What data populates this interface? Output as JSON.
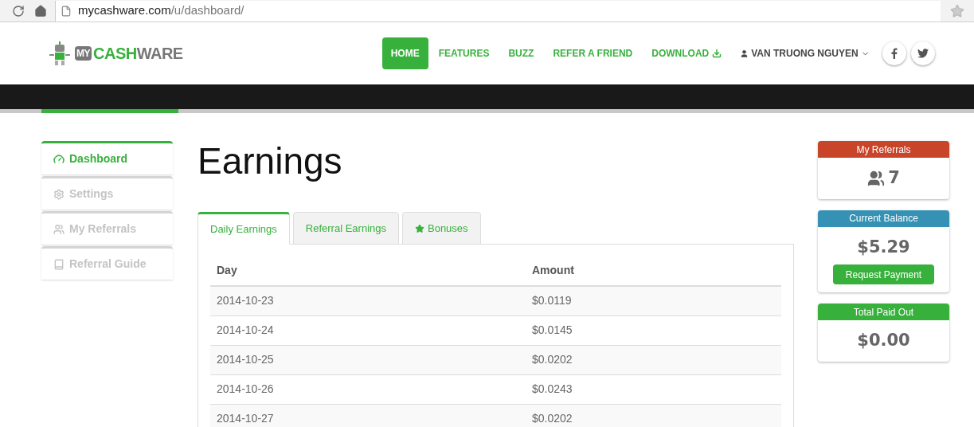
{
  "browser": {
    "url_host": "mycashware.com",
    "url_path": "/u/dashboard/"
  },
  "logo": {
    "my": "MY",
    "cash": "CASH",
    "ware": "WARE"
  },
  "nav": [
    {
      "label": "HOME",
      "selected": true,
      "kind": "plain"
    },
    {
      "label": "FEATURES",
      "selected": false,
      "kind": "plain"
    },
    {
      "label": "BUZZ",
      "selected": false,
      "kind": "plain"
    },
    {
      "label": "REFER A FRIEND",
      "selected": false,
      "kind": "plain"
    },
    {
      "label": "DOWNLOAD",
      "selected": false,
      "kind": "download"
    }
  ],
  "user": {
    "name": "VAN TRUONG NGUYEN"
  },
  "sidebar": {
    "items": [
      {
        "label": "Dashboard",
        "selected": true,
        "kind": "dashboard"
      },
      {
        "label": "Settings",
        "selected": false,
        "kind": "settings"
      },
      {
        "label": "My Referrals",
        "selected": false,
        "kind": "users"
      },
      {
        "label": "Referral Guide",
        "selected": false,
        "kind": "book"
      }
    ]
  },
  "page_title": "Earnings",
  "tabs": [
    {
      "label": "Daily Earnings",
      "selected": true,
      "kind": "plain"
    },
    {
      "label": "Referral Earnings",
      "selected": false,
      "kind": "plain"
    },
    {
      "label": "Bonuses",
      "selected": false,
      "kind": "star"
    }
  ],
  "table": {
    "columns": [
      "Day",
      "Amount"
    ],
    "rows": [
      [
        "2014-10-23",
        "$0.0119"
      ],
      [
        "2014-10-24",
        "$0.0145"
      ],
      [
        "2014-10-25",
        "$0.0202"
      ],
      [
        "2014-10-26",
        "$0.0243"
      ],
      [
        "2014-10-27",
        "$0.0202"
      ]
    ]
  },
  "cards": [
    {
      "title": "My Referrals",
      "color": "#c9452a",
      "kind": "count",
      "value": "7"
    },
    {
      "title": "Current Balance",
      "color": "#3592b5",
      "kind": "balance",
      "value": "$5.29",
      "button": "Request Payment"
    },
    {
      "title": "Total Paid Out",
      "color": "#37b13c",
      "kind": "amount",
      "value": "$0.00"
    }
  ]
}
